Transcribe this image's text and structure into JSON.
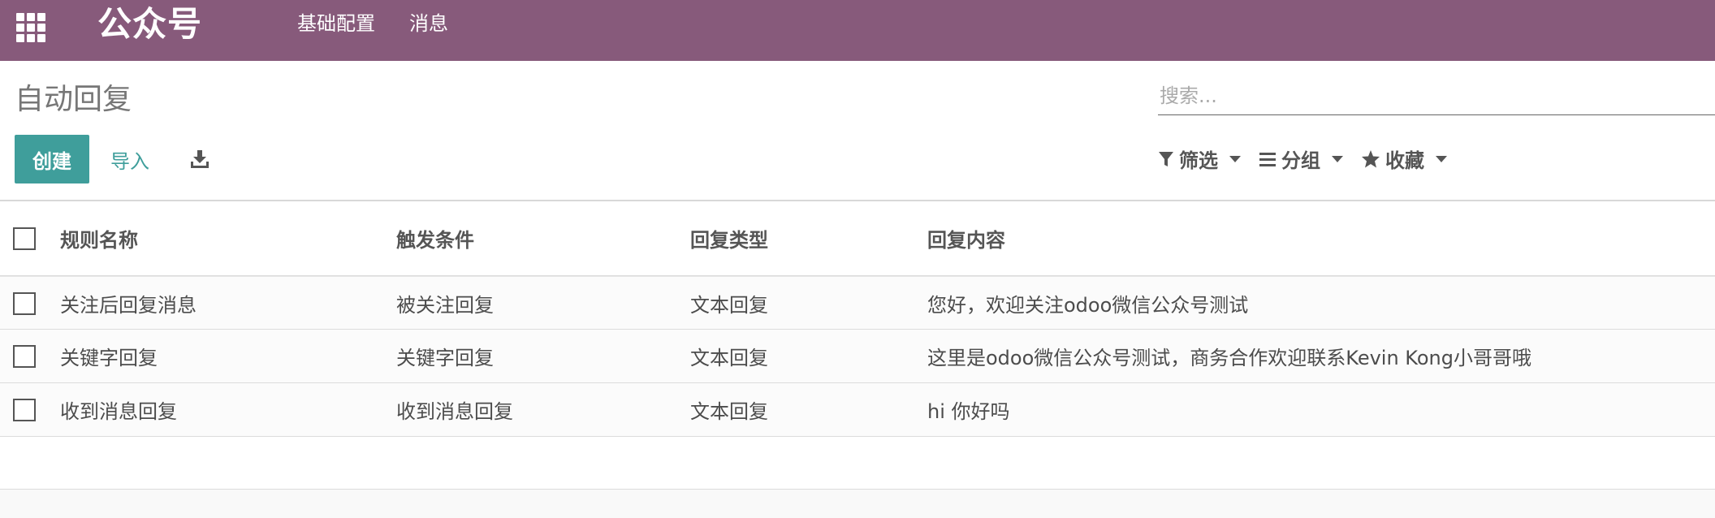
{
  "navbar": {
    "brand": "公众号",
    "menu": [
      "基础配置",
      "消息"
    ],
    "color": "#875a7b"
  },
  "control_panel": {
    "title": "自动回复",
    "search_placeholder": "搜索...",
    "create_label": "创建",
    "import_label": "导入",
    "download_icon": "download-icon",
    "filters_label": "筛选",
    "groupby_label": "分组",
    "favorites_label": "收藏",
    "accent_color": "#3f9e9b"
  },
  "table": {
    "columns": [
      "规则名称",
      "触发条件",
      "回复类型",
      "回复内容"
    ],
    "rows": [
      [
        "关注后回复消息",
        "被关注回复",
        "文本回复",
        "您好，欢迎关注odoo微信公众号测试"
      ],
      [
        "关键字回复",
        "关键字回复",
        "文本回复",
        "这里是odoo微信公众号测试，商务合作欢迎联系Kevin Kong小哥哥哦"
      ],
      [
        "收到消息回复",
        "收到消息回复",
        "文本回复",
        "hi 你好吗"
      ]
    ]
  }
}
